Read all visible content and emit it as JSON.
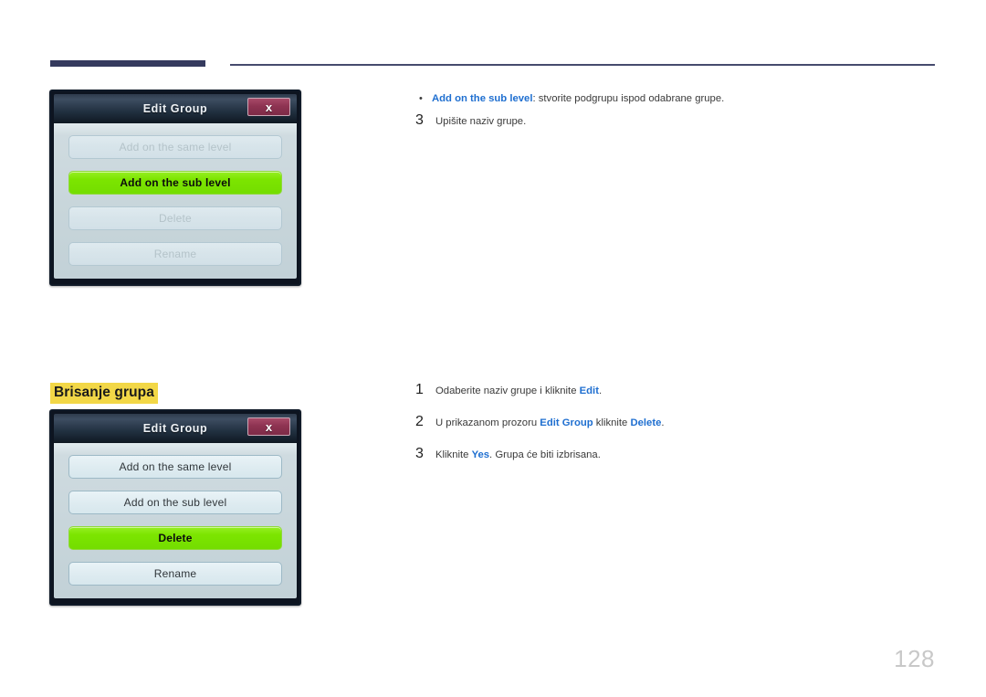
{
  "page": {
    "number": "128"
  },
  "header": {
    "rule_left": "",
    "rule_right": ""
  },
  "dialogs": [
    {
      "id": "edit-group-sub-level",
      "title": "Edit Group",
      "close_label": "x",
      "buttons": [
        {
          "label": "Add on the same level",
          "state": "disabled"
        },
        {
          "label": "Add on the sub level",
          "state": "selected"
        },
        {
          "label": "Delete",
          "state": "disabled"
        },
        {
          "label": "Rename",
          "state": "disabled"
        }
      ]
    },
    {
      "id": "edit-group-delete",
      "title": "Edit Group",
      "close_label": "x",
      "buttons": [
        {
          "label": "Add on the same level",
          "state": "normal"
        },
        {
          "label": "Add on the sub level",
          "state": "normal"
        },
        {
          "label": "Delete",
          "state": "selected"
        },
        {
          "label": "Rename",
          "state": "normal"
        }
      ]
    }
  ],
  "section": {
    "heading": "Brisanje grupa"
  },
  "top_content": {
    "bullet": {
      "marker": "•",
      "term": "Add on the sub level",
      "rest": ": stvorite podgrupu ispod odabrane grupe."
    },
    "step": {
      "number": "3",
      "text": "Upišite naziv grupe."
    }
  },
  "delete_steps": [
    {
      "number": "1",
      "pre": "Odaberite naziv grupe i kliknite ",
      "term": "Edit",
      "post": "."
    },
    {
      "number": "2",
      "pre": "U prikazanom prozoru ",
      "term": "Edit Group",
      "mid": " kliknite ",
      "term2": "Delete",
      "post": "."
    },
    {
      "number": "3",
      "pre": "Kliknite ",
      "term": "Yes",
      "post": ". Grupa će biti izbrisana."
    }
  ]
}
